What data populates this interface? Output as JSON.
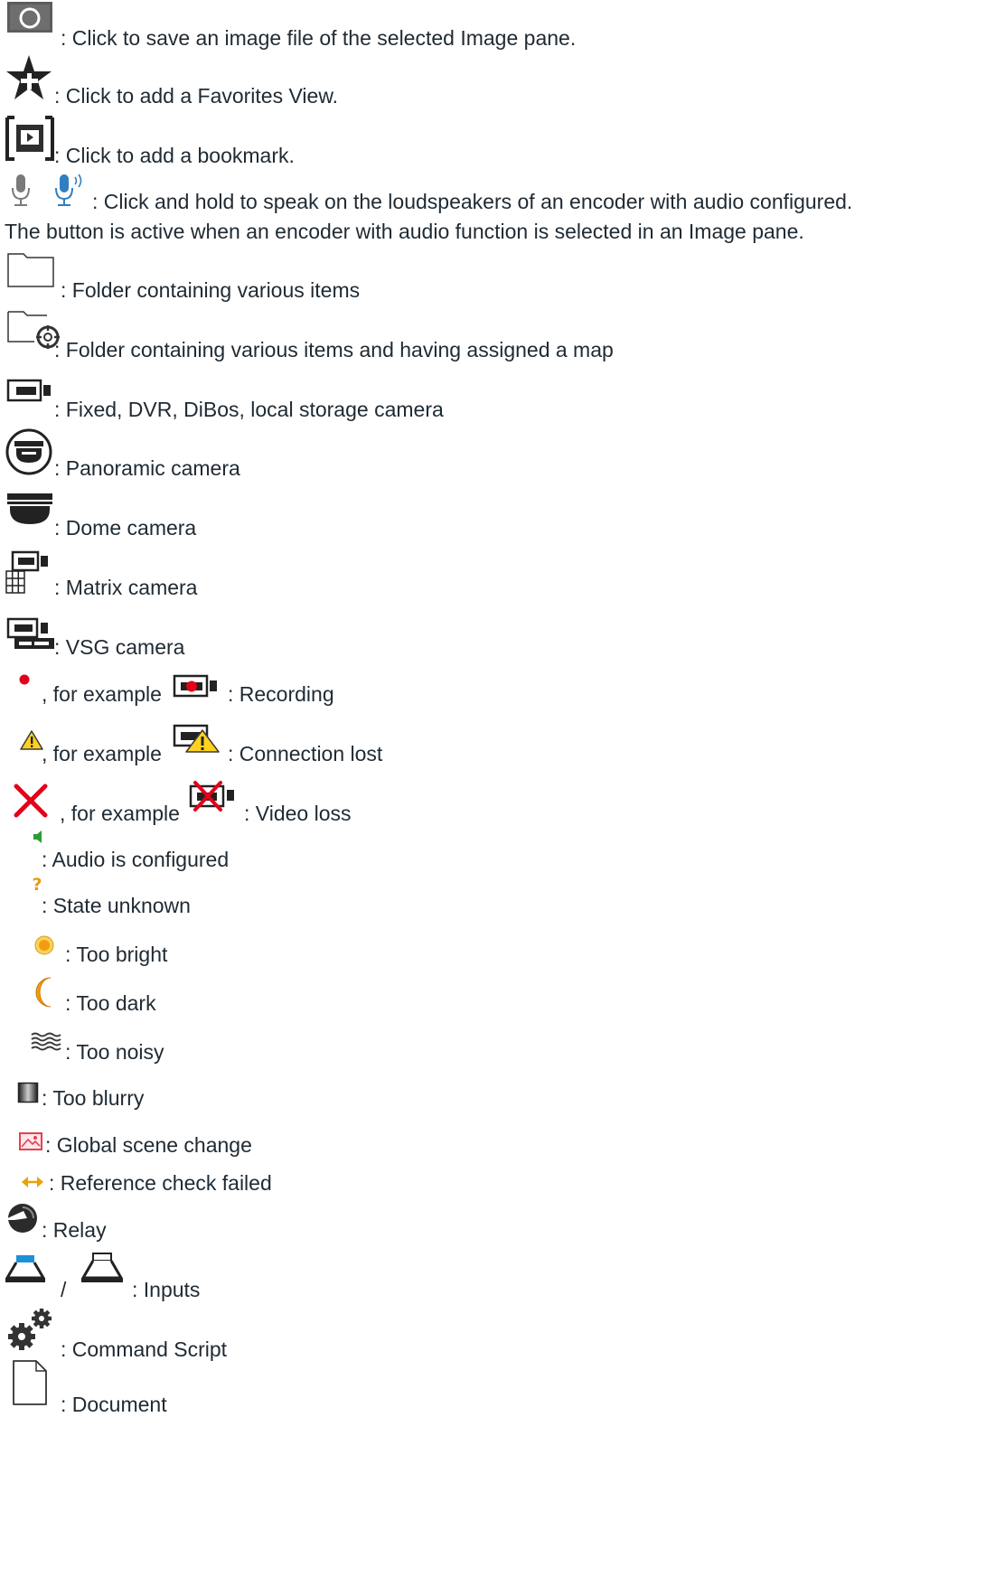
{
  "items": {
    "snapshot": ": Click to save an image file of the selected Image pane.",
    "favorites": ": Click to add a Favorites View.",
    "bookmark": ": Click to add a bookmark.",
    "speak": ": Click and hold to speak on the loudspeakers of an encoder with audio configured.",
    "speak_cont": "The button is active when an encoder with audio function is selected in an Image pane.",
    "folder": ": Folder containing various items",
    "folder_map": ": Folder containing various items and having assigned a map",
    "fixed_camera": ": Fixed, DVR, DiBos, local storage camera",
    "panoramic": ": Panoramic camera",
    "dome": ": Dome camera",
    "matrix": ": Matrix camera",
    "vsg": ": VSG camera",
    "for_example": ", for example",
    "recording": ": Recording",
    "connection_lost": ": Connection lost",
    "video_loss": ": Video loss",
    "audio_configured": ": Audio is configured",
    "state_unknown": ": State unknown",
    "too_bright": ": Too bright",
    "too_dark": ": Too dark",
    "too_noisy": ": Too noisy",
    "too_blurry": ": Too blurry",
    "global_scene": ": Global scene change",
    "reference_check": ": Reference check failed",
    "relay": ": Relay",
    "inputs_sep": "/",
    "inputs": ": Inputs",
    "command_script": ": Command Script",
    "document": ": Document"
  },
  "colors": {
    "text": "#1f2a33",
    "icon_dark": "#222222",
    "icon_gray": "#5a5a5a",
    "mic_blue": "#2f7fc1",
    "recording_red": "#e3001b",
    "warning_yellow": "#ffd21f",
    "orange": "#f39c12",
    "input_blue": "#1e90d6"
  }
}
